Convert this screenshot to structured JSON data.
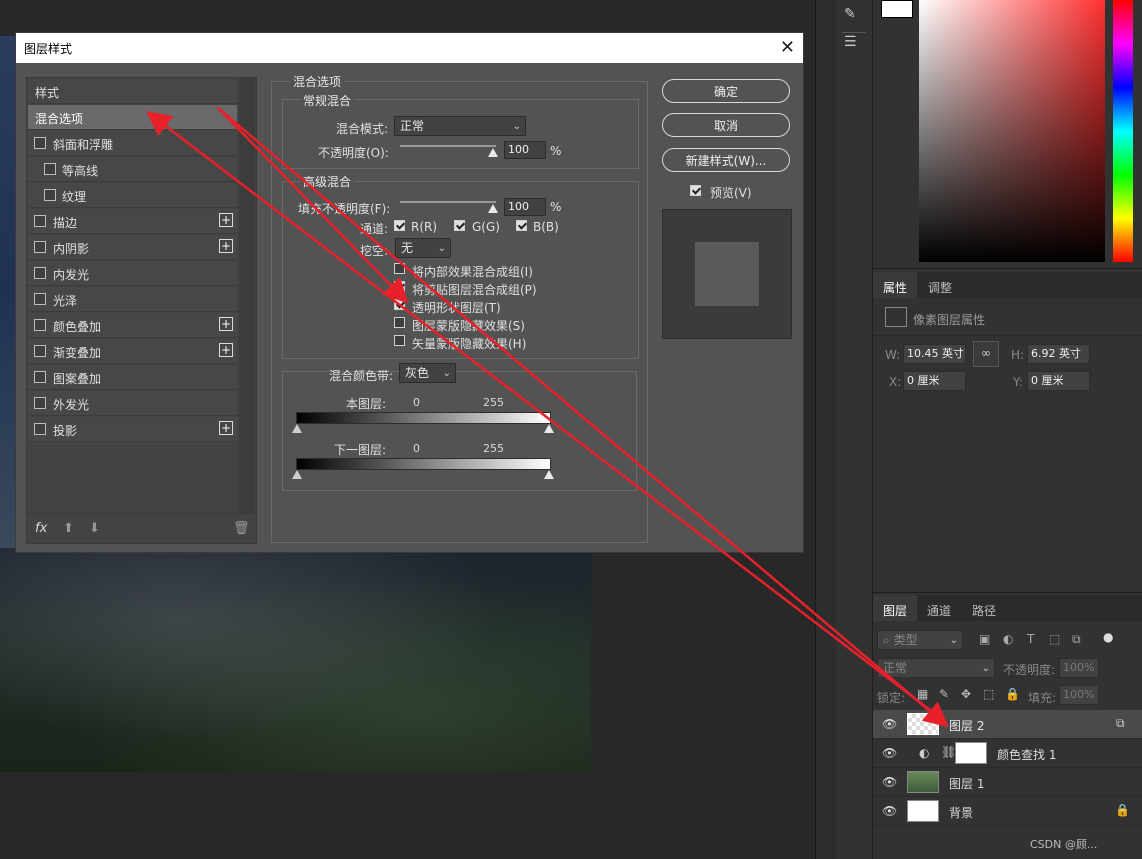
{
  "dialog": {
    "title": "图层样式",
    "close": "✕",
    "styles_header": "样式",
    "blend_options_item": "混合选项",
    "items": [
      {
        "label": "斜面和浮雕",
        "plus": false,
        "indent": false
      },
      {
        "label": "等高线",
        "plus": false,
        "indent": true
      },
      {
        "label": "纹理",
        "plus": false,
        "indent": true
      },
      {
        "label": "描边",
        "plus": true,
        "indent": false
      },
      {
        "label": "内阴影",
        "plus": true,
        "indent": false
      },
      {
        "label": "内发光",
        "plus": false,
        "indent": false
      },
      {
        "label": "光泽",
        "plus": false,
        "indent": false
      },
      {
        "label": "颜色叠加",
        "plus": true,
        "indent": false
      },
      {
        "label": "渐变叠加",
        "plus": true,
        "indent": false
      },
      {
        "label": "图案叠加",
        "plus": false,
        "indent": false
      },
      {
        "label": "外发光",
        "plus": false,
        "indent": false
      },
      {
        "label": "投影",
        "plus": true,
        "indent": false
      }
    ],
    "fx": "fx",
    "blend_section": "混合选项",
    "general_blend": "常规混合",
    "blend_mode_label": "混合模式:",
    "blend_mode_value": "正常",
    "opacity_label": "不透明度(O):",
    "opacity_value": "100",
    "percent": "%",
    "advanced_blend": "高级混合",
    "fill_opacity_label": "填充不透明度(F):",
    "fill_opacity_value": "100",
    "channels_label": "通道:",
    "channel_r": "R(R)",
    "channel_g": "G(G)",
    "channel_b": "B(B)",
    "knockout_label": "挖空:",
    "knockout_value": "无",
    "opt1": "将内部效果混合成组(I)",
    "opt2": "将剪贴图层混合成组(P)",
    "opt3": "透明形状图层(T)",
    "opt4": "图层蒙版隐藏效果(S)",
    "opt5": "矢量蒙版隐藏效果(H)",
    "blend_if_label": "混合颜色带:",
    "blend_if_value": "灰色",
    "this_layer": "本图层:",
    "under_layer": "下一图层:",
    "v0": "0",
    "v255": "255",
    "ok": "确定",
    "cancel": "取消",
    "new_style": "新建样式(W)...",
    "preview": "预览(V)"
  },
  "props": {
    "tab_props": "属性",
    "tab_adjust": "调整",
    "pixel_layer": "像素图层属性",
    "w_label": "W:",
    "w_value": "10.45 英寸",
    "h_label": "H:",
    "h_value": "6.92 英寸",
    "x_label": "X:",
    "x_value": "0 厘米",
    "y_label": "Y:",
    "y_value": "0 厘米"
  },
  "layers": {
    "tab_layers": "图层",
    "tab_channels": "通道",
    "tab_paths": "路径",
    "filter_placeholder": "类型",
    "blend": "正常",
    "opacity_label": "不透明度:",
    "opacity_value": "100%",
    "lock_label": "锁定:",
    "fill_label": "填充:",
    "fill_value": "100%",
    "rows": [
      "图层 2",
      "颜色查找 1",
      "图层 1",
      "背景"
    ]
  },
  "watermark": "CSDN @顾...",
  "colors": {
    "arrow": "#e8202a"
  }
}
